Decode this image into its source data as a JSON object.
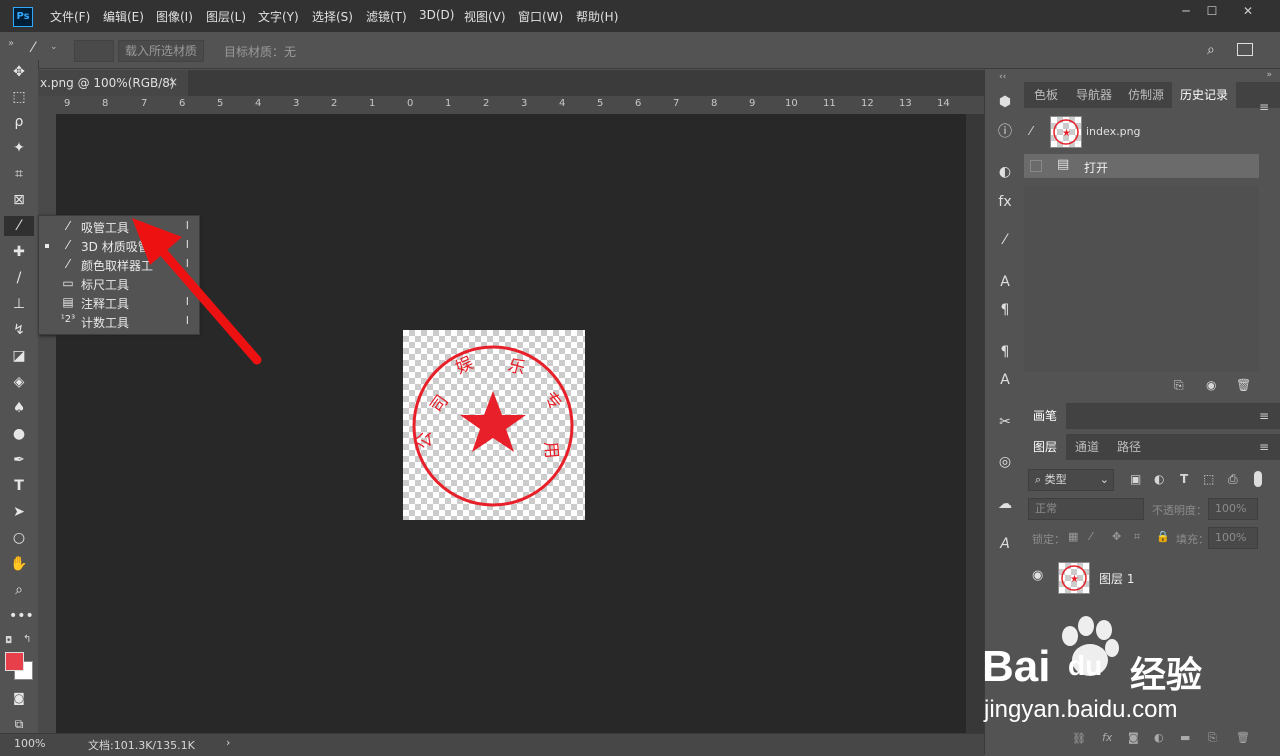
{
  "menubar": {
    "logo": "Ps",
    "items": [
      "文件(F)",
      "编辑(E)",
      "图像(I)",
      "图层(L)",
      "文字(Y)",
      "选择(S)",
      "滤镜(T)",
      "3D(D)",
      "视图(V)",
      "窗口(W)",
      "帮助(H)"
    ]
  },
  "options": {
    "load_button": "载入所选材质",
    "target_label": "目标材质：无"
  },
  "document": {
    "tab_title": "x.png @ 100%(RGB/8)",
    "close": "×",
    "ruler_ticks": [
      "9",
      "8",
      "7",
      "6",
      "5",
      "4",
      "3",
      "2",
      "1",
      "0",
      "1",
      "2",
      "3",
      "4",
      "5",
      "6",
      "7",
      "8",
      "9",
      "10",
      "11",
      "12",
      "13",
      "14"
    ]
  },
  "flyout": {
    "items": [
      {
        "label": "吸管工具",
        "key": "I",
        "icon": "eyedropper-icon"
      },
      {
        "label": "3D 材质吸管",
        "key": "I",
        "icon": "3d-eyedropper-icon"
      },
      {
        "label": "颜色取样器工",
        "key": "I",
        "icon": "color-sampler-icon"
      },
      {
        "label": "标尺工具",
        "key": "I",
        "icon": "ruler-icon"
      },
      {
        "label": "注释工具",
        "key": "I",
        "icon": "note-icon"
      },
      {
        "label": "计数工具",
        "key": "I",
        "icon": "count-icon"
      }
    ]
  },
  "stamp": {
    "chars": [
      "司",
      "娱",
      "乐",
      "专",
      "用",
      "公"
    ]
  },
  "panels": {
    "top_tabs": [
      "色板",
      "导航器",
      "仿制源",
      "历史记录"
    ],
    "history": {
      "snapshot_name": "index.png",
      "step": "打开"
    },
    "brush_tab": "画笔",
    "layer_tabs": [
      "图层",
      "通道",
      "路径"
    ],
    "layers": {
      "filter_label": "类型",
      "blend_mode": "正常",
      "opacity_label": "不透明度：",
      "opacity_value": "100%",
      "lock_label": "锁定：",
      "fill_label": "填充：",
      "fill_value": "100%",
      "layer_name": "图层 1"
    }
  },
  "status": {
    "zoom": "100%",
    "doc_info": "文档:101.3K/135.1K"
  },
  "watermark": {
    "brand": "Bai",
    "brand2": "du",
    "site_cn": "经验",
    "url": "jingyan.baidu.com"
  },
  "colors": {
    "stamp_red": "#e8202a",
    "arrow_red": "#ee1111",
    "foreground": "#e8404a"
  }
}
